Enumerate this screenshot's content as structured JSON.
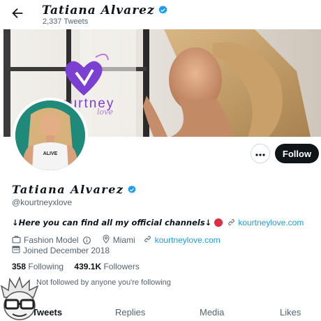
{
  "header": {
    "display_name": "Tatiana Alvarez",
    "tweet_count": "2,337 Tweets",
    "back_icon": "arrow-left-icon",
    "verified_icon": "verified-badge-icon"
  },
  "banner": {
    "logo_text": "ourtney",
    "logo_sub": "love",
    "brand_color": "#7b3fd1"
  },
  "actions": {
    "more_icon": "more-horizontal-icon",
    "follow_label": "Follow"
  },
  "profile": {
    "display_name": "Tatiana Alvarez",
    "handle": "@kourtneyxlove",
    "avatar_shirt_text": "ALIVE",
    "bio": "↓Here you can find all my official channels↓",
    "bio_link": "kourtneylove.com",
    "category": "Fashion Model",
    "location": "Miami",
    "website": "kourtneylove.com",
    "joined": "Joined December 2018"
  },
  "stats": {
    "following_count": "358",
    "following_label": "Following",
    "followers_count": "439.1K",
    "followers_label": "Followers"
  },
  "followed_by": "Not followed by anyone you're following",
  "tabs": [
    "Tweets",
    "Replies",
    "Media",
    "Likes"
  ],
  "colors": {
    "accent": "#1d9bf0",
    "text": "#0f1419",
    "muted": "#536471",
    "follow_bg": "#0f1419"
  }
}
